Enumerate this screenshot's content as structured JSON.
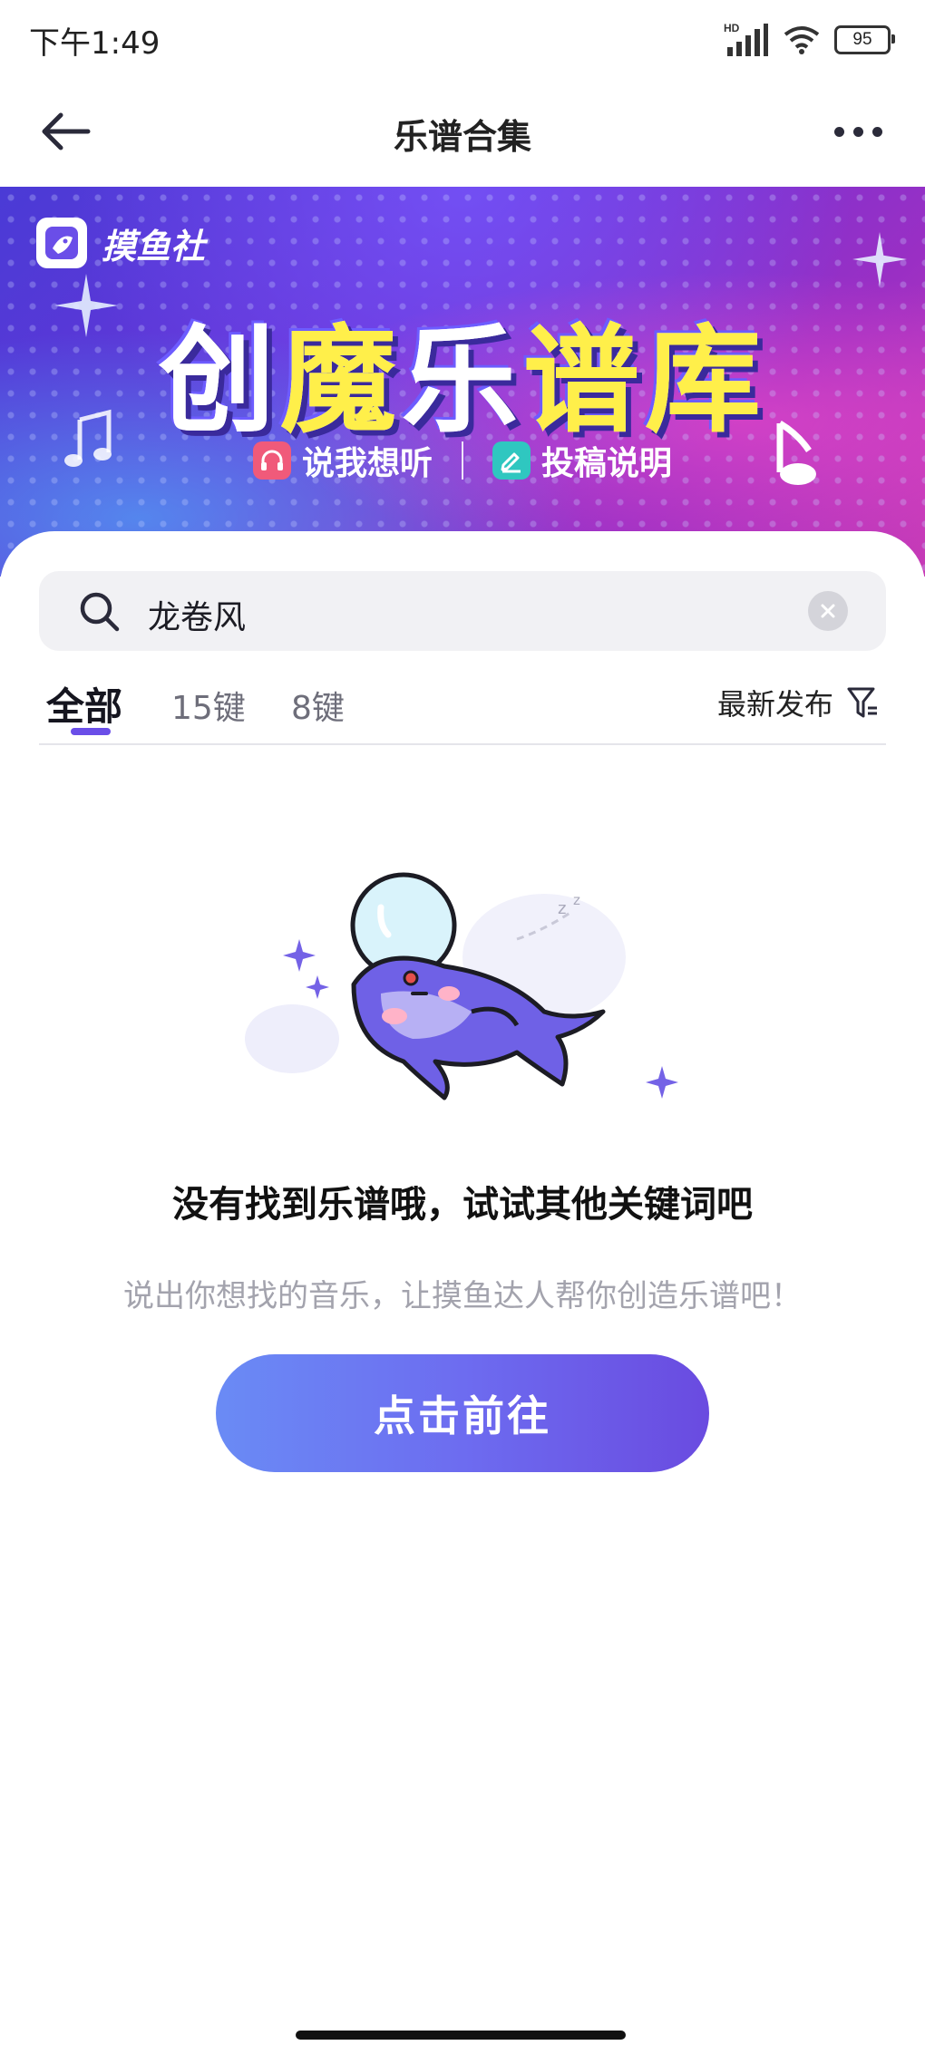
{
  "status_bar": {
    "time": "下午1:49",
    "network_label": "HD",
    "battery_level": "95",
    "icons": [
      "signal-icon",
      "wifi-icon",
      "battery-icon"
    ]
  },
  "nav": {
    "title": "乐谱合集",
    "back_icon": "arrow-left-icon",
    "more_icon": "more-dots-icon"
  },
  "banner": {
    "brand_name": "摸鱼社",
    "title_part1": "创",
    "title_part2": "魔",
    "title_part3": "乐",
    "title_part4": "谱库",
    "actions": [
      {
        "label": "说我想听",
        "icon": "headphones-icon",
        "color": "#f05a7a"
      },
      {
        "label": "投稿说明",
        "icon": "edit-icon",
        "color": "#2fc7c0"
      }
    ]
  },
  "search": {
    "value": "龙卷风",
    "search_icon": "search-icon",
    "clear_icon": "clear-icon"
  },
  "tabs": {
    "items": [
      "全部",
      "15键",
      "8键"
    ],
    "active_index": 0,
    "sort_label": "最新发布",
    "sort_icon": "filter-icon"
  },
  "empty_state": {
    "title": "没有找到乐谱哦，试试其他关键词吧",
    "subtitle": "说出你想找的音乐，让摸鱼达人帮你创造乐谱吧！",
    "button_label": "点击前往"
  },
  "colors": {
    "accent": "#6a4ee8",
    "button_start": "#6a8bf5",
    "button_end": "#6a4be0"
  }
}
